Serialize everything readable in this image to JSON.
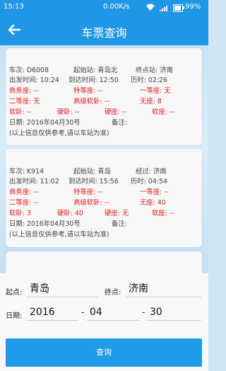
{
  "status_bar": {
    "time": "15:13",
    "network_speed": "0.00K/s",
    "battery": "99%"
  },
  "nav": {
    "title": "车票查询"
  },
  "results": [
    {
      "train_no": "车次: D6008",
      "start_station": "起始站: 青岛北",
      "end_station": "终点站: 济南",
      "depart": "出发时间: 10:24",
      "arrive": "到达时间: 12:50",
      "duration": "历时: 02:26",
      "seat_business": "商务座: --",
      "seat_premium": "特等座: --",
      "seat_first": "一等座: 无",
      "seat_second": "二等座: 无",
      "seat_deluxe_soft_sleeper": "高级软卧: --",
      "seat_standing": "无座: 8",
      "soft_sleeper": "软卧: --",
      "hard_sleeper": "硬卧: --",
      "hard_seat": "硬座: --",
      "soft_seat": "软座: --",
      "date": "日期: 2016年04月30号",
      "remark": "备注:",
      "note": "(以上信息仅供参考,请以车站为准)"
    },
    {
      "train_no": "车次: K914",
      "start_station": "起始站: 青岛",
      "end_station": "经过: 济南",
      "depart": "出发时间: 11:02",
      "arrive": "到达时间: 15:56",
      "duration": "历时: 04:54",
      "seat_business": "商务座: --",
      "seat_premium": "特等座: --",
      "seat_first": "一等座: --",
      "seat_second": "二等座: --",
      "seat_deluxe_soft_sleeper": "高级软卧: --",
      "seat_standing": "无座: 40",
      "soft_sleeper": "软卧: 3",
      "hard_sleeper": "硬卧: 40",
      "hard_seat": "硬座: 无",
      "soft_seat": "软座: --",
      "date": "日期: 2016年04月30号",
      "remark": "备注:",
      "note": "(以上信息仅供参考,请以车站为准)"
    }
  ],
  "form": {
    "from_label": "起点:",
    "from_value": "青岛",
    "to_label": "终点:",
    "to_value": "济南",
    "date_label": "日期:",
    "year": "2016",
    "month": "04",
    "day": "30",
    "separator": "-",
    "query_button": "查询"
  },
  "colors": {
    "accent": "#1f96e6",
    "seat_text": "#e02020"
  }
}
